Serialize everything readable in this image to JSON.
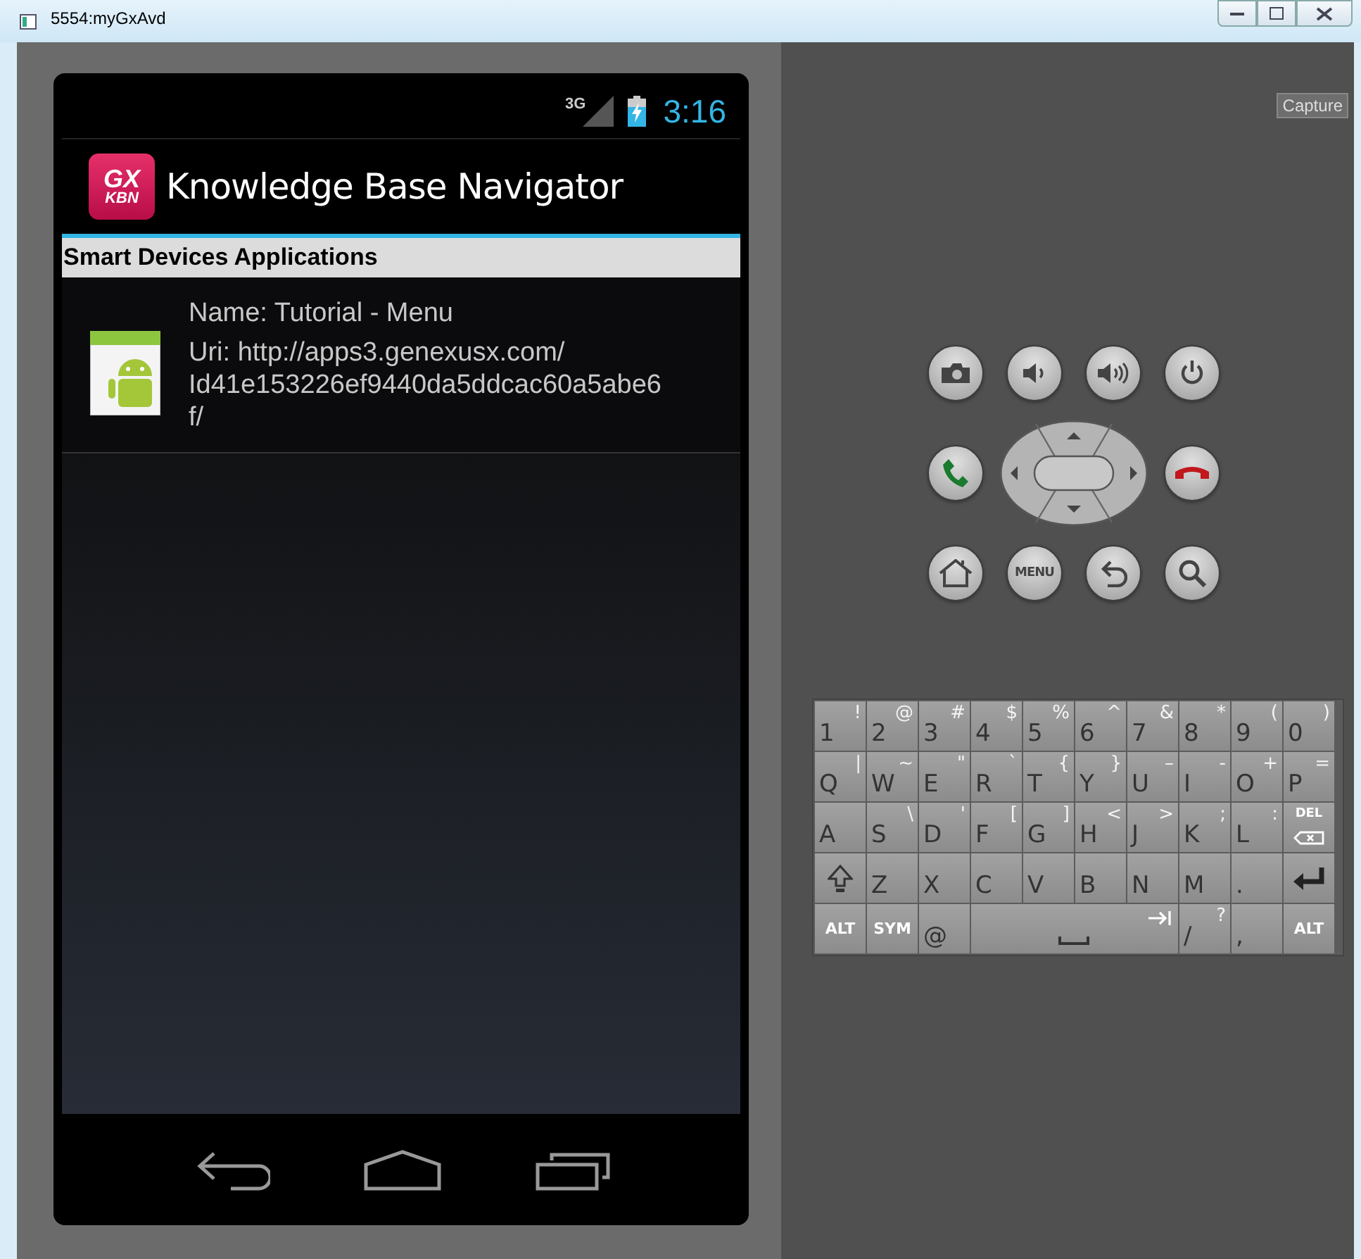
{
  "window": {
    "title": "5554:myGxAvd"
  },
  "phone": {
    "status_bar": {
      "network": "3G",
      "time": "3:16"
    },
    "action_bar": {
      "logo_top": "GX",
      "logo_bottom": "KBN",
      "title": "Knowledge Base Navigator"
    },
    "section_header": "Smart Devices Applications",
    "apps": [
      {
        "name": "Name: Tutorial - Menu",
        "uri_lines": [
          "Uri: http://apps3.genexusx.com/",
          "Id41e153226ef9440da5ddcac60a5abe6",
          "f/"
        ]
      }
    ]
  },
  "capture_button": "Capture",
  "hard_keys": [
    {
      "kind": "camera"
    },
    {
      "kind": "volume_down"
    },
    {
      "kind": "volume_up"
    },
    {
      "kind": "power"
    },
    {
      "kind": "call"
    },
    {
      "kind": "dpad"
    },
    {
      "kind": "end_call"
    },
    {
      "kind": "home"
    },
    {
      "kind": "menu",
      "label": "MENU"
    },
    {
      "kind": "back"
    },
    {
      "kind": "search"
    }
  ],
  "keyboard": {
    "rows": [
      [
        {
          "kind": "char",
          "main": "1",
          "alt": "!"
        },
        {
          "kind": "char",
          "main": "2",
          "alt": "@"
        },
        {
          "kind": "char",
          "main": "3",
          "alt": "#"
        },
        {
          "kind": "char",
          "main": "4",
          "alt": "$"
        },
        {
          "kind": "char",
          "main": "5",
          "alt": "%"
        },
        {
          "kind": "char",
          "main": "6",
          "alt": "^"
        },
        {
          "kind": "char",
          "main": "7",
          "alt": "&"
        },
        {
          "kind": "char",
          "main": "8",
          "alt": "*"
        },
        {
          "kind": "char",
          "main": "9",
          "alt": "("
        },
        {
          "kind": "char",
          "main": "0",
          "alt": ")"
        }
      ],
      [
        {
          "kind": "char",
          "main": "Q",
          "alt": "|"
        },
        {
          "kind": "char",
          "main": "W",
          "alt": "~"
        },
        {
          "kind": "char",
          "main": "E",
          "alt": "\""
        },
        {
          "kind": "char",
          "main": "R",
          "alt": "`"
        },
        {
          "kind": "char",
          "main": "T",
          "alt": "{"
        },
        {
          "kind": "char",
          "main": "Y",
          "alt": "}"
        },
        {
          "kind": "char",
          "main": "U",
          "alt": "–"
        },
        {
          "kind": "char",
          "main": "I",
          "alt": "-"
        },
        {
          "kind": "char",
          "main": "O",
          "alt": "+"
        },
        {
          "kind": "char",
          "main": "P",
          "alt": "="
        }
      ],
      [
        {
          "kind": "char",
          "main": "A"
        },
        {
          "kind": "char",
          "main": "S",
          "alt": "\\"
        },
        {
          "kind": "char",
          "main": "D",
          "alt": "'"
        },
        {
          "kind": "char",
          "main": "F",
          "alt": "["
        },
        {
          "kind": "char",
          "main": "G",
          "alt": "]"
        },
        {
          "kind": "char",
          "main": "H",
          "alt": "<"
        },
        {
          "kind": "char",
          "main": "J",
          "alt": ">"
        },
        {
          "kind": "char",
          "main": "K",
          "alt": ";"
        },
        {
          "kind": "char",
          "main": "L",
          "alt": ":"
        },
        {
          "kind": "delete",
          "label": "DEL"
        }
      ],
      [
        {
          "kind": "shift"
        },
        {
          "kind": "char",
          "main": "Z"
        },
        {
          "kind": "char",
          "main": "X"
        },
        {
          "kind": "char",
          "main": "C"
        },
        {
          "kind": "char",
          "main": "V"
        },
        {
          "kind": "char",
          "main": "B"
        },
        {
          "kind": "char",
          "main": "N"
        },
        {
          "kind": "char",
          "main": "M"
        },
        {
          "kind": "char",
          "main": "."
        },
        {
          "kind": "enter"
        }
      ],
      [
        {
          "kind": "label",
          "label": "ALT"
        },
        {
          "kind": "label",
          "label": "SYM"
        },
        {
          "kind": "char",
          "main": "@"
        },
        {
          "kind": "space",
          "colspan": 4
        },
        {
          "kind": "char",
          "main": "/",
          "alt": "?"
        },
        {
          "kind": "char",
          "main": ","
        },
        {
          "kind": "label",
          "label": "ALT"
        }
      ]
    ]
  }
}
